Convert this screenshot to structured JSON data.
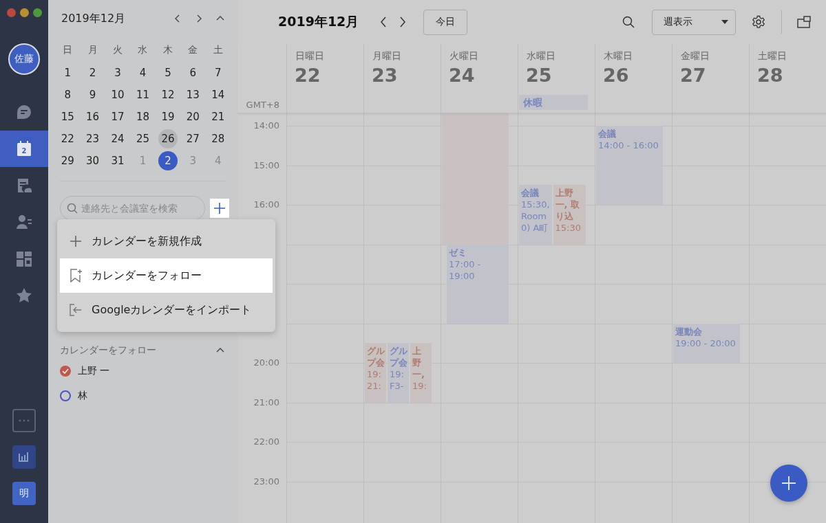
{
  "rail": {
    "avatar": "佐藤",
    "items": [
      {
        "kind": "chat",
        "selected": false
      },
      {
        "kind": "calendar",
        "label": "2",
        "selected": true
      },
      {
        "kind": "tasks",
        "selected": false
      },
      {
        "kind": "contacts",
        "selected": false
      },
      {
        "kind": "apps",
        "selected": false
      },
      {
        "kind": "star",
        "selected": false
      }
    ],
    "bottom": [
      {
        "kind": "more"
      },
      {
        "kind": "stats"
      },
      {
        "kind": "avatar",
        "label": "明"
      }
    ]
  },
  "mini_calendar": {
    "title": "2019年12月",
    "expanded": true,
    "weekdays": [
      "日",
      "月",
      "火",
      "水",
      "木",
      "金",
      "土"
    ],
    "weeks": [
      [
        {
          "d": "1",
          "other_month": false,
          "today": false,
          "selected": false
        },
        {
          "d": "2",
          "other_month": false,
          "today": false,
          "selected": false
        },
        {
          "d": "3",
          "other_month": false,
          "today": false,
          "selected": false
        },
        {
          "d": "4",
          "other_month": false,
          "today": false,
          "selected": false
        },
        {
          "d": "5",
          "other_month": false,
          "today": false,
          "selected": false
        },
        {
          "d": "6",
          "other_month": false,
          "today": false,
          "selected": false
        },
        {
          "d": "7",
          "other_month": false,
          "today": false,
          "selected": false
        }
      ],
      [
        {
          "d": "8",
          "other_month": false,
          "today": false,
          "selected": false
        },
        {
          "d": "9",
          "other_month": false,
          "today": false,
          "selected": false
        },
        {
          "d": "10",
          "other_month": false,
          "today": false,
          "selected": false
        },
        {
          "d": "11",
          "other_month": false,
          "today": false,
          "selected": false
        },
        {
          "d": "12",
          "other_month": false,
          "today": false,
          "selected": false
        },
        {
          "d": "13",
          "other_month": false,
          "today": false,
          "selected": false
        },
        {
          "d": "14",
          "other_month": false,
          "today": false,
          "selected": false
        }
      ],
      [
        {
          "d": "15",
          "other_month": false,
          "today": false,
          "selected": false
        },
        {
          "d": "16",
          "other_month": false,
          "today": false,
          "selected": false
        },
        {
          "d": "17",
          "other_month": false,
          "today": false,
          "selected": false
        },
        {
          "d": "18",
          "other_month": false,
          "today": false,
          "selected": false
        },
        {
          "d": "19",
          "other_month": false,
          "today": false,
          "selected": false
        },
        {
          "d": "20",
          "other_month": false,
          "today": false,
          "selected": false
        },
        {
          "d": "21",
          "other_month": false,
          "today": false,
          "selected": false
        }
      ],
      [
        {
          "d": "22",
          "other_month": false,
          "today": false,
          "selected": false
        },
        {
          "d": "23",
          "other_month": false,
          "today": false,
          "selected": false
        },
        {
          "d": "24",
          "other_month": false,
          "today": false,
          "selected": false
        },
        {
          "d": "25",
          "other_month": false,
          "today": false,
          "selected": false
        },
        {
          "d": "26",
          "other_month": false,
          "today": true,
          "selected": false
        },
        {
          "d": "27",
          "other_month": false,
          "today": false,
          "selected": false
        },
        {
          "d": "28",
          "other_month": false,
          "today": false,
          "selected": false
        }
      ],
      [
        {
          "d": "29",
          "other_month": false,
          "today": false,
          "selected": false
        },
        {
          "d": "30",
          "other_month": false,
          "today": false,
          "selected": false
        },
        {
          "d": "31",
          "other_month": false,
          "today": false,
          "selected": false
        },
        {
          "d": "1",
          "other_month": true,
          "today": false,
          "selected": false
        },
        {
          "d": "2",
          "other_month": true,
          "today": false,
          "selected": true
        },
        {
          "d": "3",
          "other_month": true,
          "today": false,
          "selected": false
        },
        {
          "d": "4",
          "other_month": true,
          "today": false,
          "selected": false
        }
      ]
    ]
  },
  "search": {
    "placeholder": "連絡先と会議室を検索"
  },
  "menu": {
    "items": [
      {
        "kind": "new",
        "label": "カレンダーを新規作成",
        "selected": false
      },
      {
        "kind": "follow",
        "label": "カレンダーをフォロー",
        "selected": true
      },
      {
        "kind": "import",
        "label": "Googleカレンダーをインポート",
        "selected": false
      }
    ]
  },
  "followed": {
    "title": "カレンダーをフォロー",
    "expanded": true,
    "calendars": [
      {
        "name": "上野 一",
        "checked": true,
        "color": "#c0584c"
      },
      {
        "name": "林",
        "checked": false,
        "color": "#4a55c2"
      }
    ]
  },
  "toolbar": {
    "title": "2019年12月",
    "today": "今日",
    "view": "週表示"
  },
  "week": {
    "timezone": "GMT+8",
    "hours_above_menu": [
      "14:00",
      "15:00",
      "16:00"
    ],
    "hours_below_menu": [
      "20:00",
      "21:00",
      "22:00",
      "23:00"
    ],
    "days": [
      {
        "weekday": "日曜日",
        "date": "22"
      },
      {
        "weekday": "月曜日",
        "date": "23",
        "events": [
          {
            "color": "#b07c72",
            "title_lines": [
              "グル",
              "プ会"
            ],
            "detail_lines": [
              "19:",
              "21:"
            ]
          },
          {
            "color": "#7b86bb",
            "title_lines": [
              "グル",
              "プ会"
            ],
            "detail_lines": [
              "19:",
              "F3-"
            ]
          },
          {
            "color": "#b07c72",
            "title_lines": [
              "上",
              "野",
              "一,"
            ],
            "detail_lines": [
              "19:"
            ]
          }
        ]
      },
      {
        "weekday": "火曜日",
        "date": "24",
        "events": [
          {
            "color": "#cac2c1"
          },
          {
            "color": "#7b86bb",
            "title_lines": [
              "ゼミ"
            ],
            "detail_lines": [
              "17:00 -",
              "19:00"
            ]
          }
        ]
      },
      {
        "weekday": "水曜日",
        "date": "25",
        "all_day": [
          {
            "title": "休暇",
            "color": "#7b86bb"
          }
        ],
        "events": [
          {
            "color": "#7b86bb",
            "title_lines": [
              "会議"
            ],
            "detail_lines": [
              "15:30,",
              "Room",
              "0) A町"
            ]
          },
          {
            "color": "#b07c72",
            "title_lines": [
              "上野",
              "一, 取",
              "り込"
            ],
            "detail_lines": [
              "15:30"
            ]
          }
        ]
      },
      {
        "weekday": "木曜日",
        "date": "26",
        "events": [
          {
            "color": "#7b86bb",
            "title_lines": [
              "会議"
            ],
            "detail_lines": [
              "14:00 - 16:00"
            ]
          }
        ]
      },
      {
        "weekday": "金曜日",
        "date": "27",
        "events": [
          {
            "color": "#7b86bb",
            "title_lines": [
              "運動会"
            ],
            "detail_lines": [
              "19:00 - 20:00"
            ]
          }
        ]
      },
      {
        "weekday": "土曜日",
        "date": "28"
      }
    ]
  }
}
